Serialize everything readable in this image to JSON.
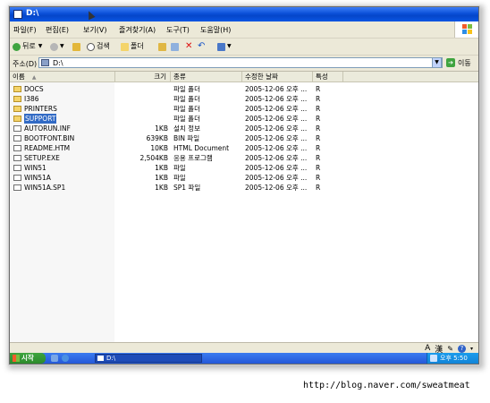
{
  "window": {
    "title": "D:\\"
  },
  "menu": [
    "파일(F)",
    "편집(E)",
    "보기(V)",
    "즐겨찾기(A)",
    "도구(T)",
    "도움말(H)"
  ],
  "toolbar": {
    "back": "뒤로",
    "search": "검색",
    "folders": "폴더"
  },
  "address": {
    "label": "주소(D)",
    "value": "D:\\",
    "go": "이동"
  },
  "columns": {
    "name": "이름",
    "size": "크기",
    "type": "종류",
    "modified": "수정한 날짜",
    "attr": "특성"
  },
  "files": [
    {
      "name": "DOCS",
      "size": "",
      "type": "파일 폴더",
      "modified": "2005-12-06 오후 ...",
      "attr": "R",
      "kind": "folder",
      "selected": false
    },
    {
      "name": "I386",
      "size": "",
      "type": "파일 폴더",
      "modified": "2005-12-06 오후 ...",
      "attr": "R",
      "kind": "folder",
      "selected": false
    },
    {
      "name": "PRINTERS",
      "size": "",
      "type": "파일 폴더",
      "modified": "2005-12-06 오후 ...",
      "attr": "R",
      "kind": "folder",
      "selected": false
    },
    {
      "name": "SUPPORT",
      "size": "",
      "type": "파일 폴더",
      "modified": "2005-12-06 오후 ...",
      "attr": "R",
      "kind": "folder",
      "selected": true
    },
    {
      "name": "AUTORUN.INF",
      "size": "1KB",
      "type": "설치 정보",
      "modified": "2005-12-06 오후 ...",
      "attr": "R",
      "kind": "file",
      "selected": false
    },
    {
      "name": "BOOTFONT.BIN",
      "size": "639KB",
      "type": "BIN 파일",
      "modified": "2005-12-06 오후 ...",
      "attr": "R",
      "kind": "file",
      "selected": false
    },
    {
      "name": "README.HTM",
      "size": "10KB",
      "type": "HTML Document",
      "modified": "2005-12-06 오후 ...",
      "attr": "R",
      "kind": "file",
      "selected": false
    },
    {
      "name": "SETUP.EXE",
      "size": "2,504KB",
      "type": "응용 프로그램",
      "modified": "2005-12-06 오후 ...",
      "attr": "R",
      "kind": "file",
      "selected": false
    },
    {
      "name": "WIN51",
      "size": "1KB",
      "type": "파일",
      "modified": "2005-12-06 오후 ...",
      "attr": "R",
      "kind": "file",
      "selected": false
    },
    {
      "name": "WIN51A",
      "size": "1KB",
      "type": "파일",
      "modified": "2005-12-06 오후 ...",
      "attr": "R",
      "kind": "file",
      "selected": false
    },
    {
      "name": "WIN51A.SP1",
      "size": "1KB",
      "type": "SP1 파일",
      "modified": "2005-12-06 오후 ...",
      "attr": "R",
      "kind": "file",
      "selected": false
    }
  ],
  "ime": {
    "mode": "A",
    "hanja": "漢"
  },
  "taskbar": {
    "start": "시작",
    "task": "D:\\",
    "clock": "오후 5:50"
  },
  "watermark": "http://blog.naver.com/sweatmeat",
  "colors": {
    "selection": "#316ac5",
    "titlebar": "#0a4fd8",
    "chrome": "#ece9d8"
  }
}
